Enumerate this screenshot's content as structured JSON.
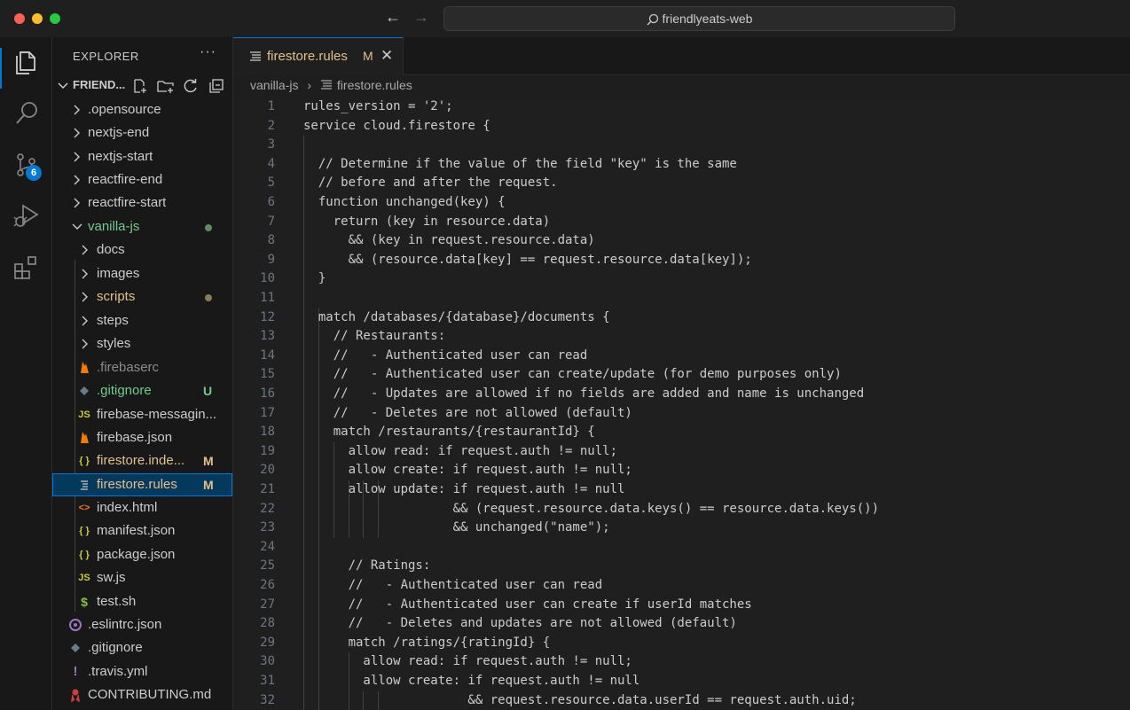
{
  "window": {
    "search_text": "friendlyeats-web"
  },
  "colors": {
    "accent": "#0078d4",
    "modified": "#e2c08d",
    "untracked": "#73c991",
    "editor_bg": "#1f1f1f"
  },
  "activity_bar": {
    "items": [
      {
        "name": "explorer-icon"
      },
      {
        "name": "search-icon"
      },
      {
        "name": "source-control-icon",
        "badge": "6"
      },
      {
        "name": "run-debug-icon"
      },
      {
        "name": "extensions-icon"
      }
    ]
  },
  "sidebar": {
    "title": "EXPLORER",
    "more": "···",
    "project": "FRIEND...",
    "tree": [
      {
        "label": "nextjs-end"
      },
      {
        "label": ".opensource"
      },
      {
        "label": "nextjs-start"
      },
      {
        "label": "reactfire-end"
      },
      {
        "label": "reactfire-start"
      },
      {
        "label": "vanilla-js"
      },
      {
        "label": "docs"
      },
      {
        "label": "images"
      },
      {
        "label": "scripts"
      },
      {
        "label": "steps"
      },
      {
        "label": "styles"
      },
      {
        "label": ".firebaserc"
      },
      {
        "label": ".gitignore",
        "status": "U"
      },
      {
        "label": "firebase-messagin..."
      },
      {
        "label": "firebase.json"
      },
      {
        "label": "firestore.inde...",
        "status": "M"
      },
      {
        "label": "firestore.rules",
        "status": "M"
      },
      {
        "label": "index.html"
      },
      {
        "label": "manifest.json"
      },
      {
        "label": "package.json"
      },
      {
        "label": "sw.js"
      },
      {
        "label": "test.sh"
      },
      {
        "label": ".eslintrc.json"
      },
      {
        "label": ".gitignore"
      },
      {
        "label": ".travis.yml"
      },
      {
        "label": "CONTRIBUTING.md"
      }
    ]
  },
  "editor": {
    "tab": {
      "label": "firestore.rules",
      "modified": "M",
      "close": "✕"
    },
    "breadcrumb": [
      "vanilla-js",
      "firestore.rules"
    ],
    "lines": [
      "rules_version = '2';",
      "service cloud.firestore {",
      "",
      "  // Determine if the value of the field \"key\" is the same",
      "  // before and after the request.",
      "  function unchanged(key) {",
      "    return (key in resource.data)",
      "      && (key in request.resource.data)",
      "      && (resource.data[key] == request.resource.data[key]);",
      "  }",
      "",
      "  match /databases/{database}/documents {",
      "    // Restaurants:",
      "    //   - Authenticated user can read",
      "    //   - Authenticated user can create/update (for demo purposes only)",
      "    //   - Updates are allowed if no fields are added and name is unchanged",
      "    //   - Deletes are not allowed (default)",
      "    match /restaurants/{restaurantId} {",
      "      allow read: if request.auth != null;",
      "      allow create: if request.auth != null;",
      "      allow update: if request.auth != null",
      "                    && (request.resource.data.keys() == resource.data.keys())",
      "                    && unchanged(\"name\");",
      "",
      "      // Ratings:",
      "      //   - Authenticated user can read",
      "      //   - Authenticated user can create if userId matches",
      "      //   - Deletes and updates are not allowed (default)",
      "      match /ratings/{ratingId} {",
      "        allow read: if request.auth != null;",
      "        allow create: if request.auth != null",
      "                      && request.resource.data.userId == request.auth.uid;"
    ]
  }
}
